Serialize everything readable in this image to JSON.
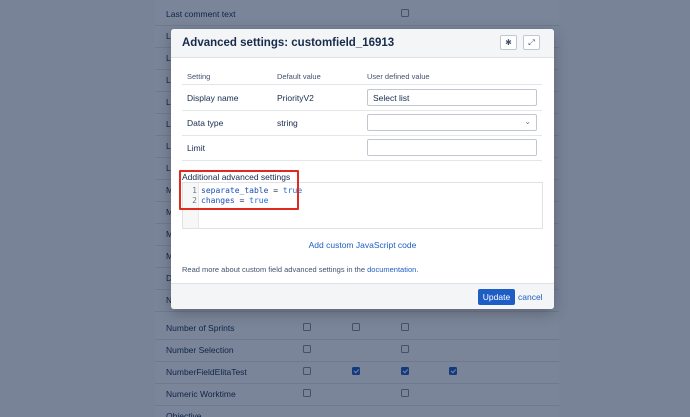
{
  "background": {
    "rows": [
      {
        "label": "Last comment text",
        "checks": [
          false,
          null,
          null,
          null
        ]
      },
      {
        "label": "L",
        "checks": [
          null,
          null,
          null,
          null
        ]
      },
      {
        "label": "L",
        "checks": [
          null,
          null,
          null,
          null
        ]
      },
      {
        "label": "L",
        "checks": [
          null,
          null,
          null,
          null
        ]
      },
      {
        "label": "L",
        "checks": [
          null,
          null,
          null,
          null
        ]
      },
      {
        "label": "L",
        "checks": [
          null,
          null,
          null,
          null
        ]
      },
      {
        "label": "L",
        "checks": [
          null,
          null,
          null,
          null
        ]
      },
      {
        "label": "L",
        "checks": [
          null,
          null,
          null,
          null
        ]
      },
      {
        "label": "M",
        "checks": [
          null,
          null,
          null,
          null
        ]
      },
      {
        "label": "M",
        "checks": [
          null,
          null,
          null,
          null
        ]
      },
      {
        "label": "M",
        "checks": [
          null,
          null,
          null,
          null
        ]
      },
      {
        "label": "M",
        "checks": [
          null,
          null,
          null,
          null
        ]
      },
      {
        "label": "D",
        "checks": [
          null,
          null,
          null,
          null
        ]
      },
      {
        "label": "N",
        "checks": [
          null,
          null,
          null,
          null
        ]
      },
      {
        "label": "Number of Sprints",
        "checks": [
          false,
          false,
          false,
          null
        ]
      },
      {
        "label": "Number Selection",
        "checks": [
          false,
          null,
          false,
          null
        ]
      },
      {
        "label": "NumberFieldElitaTest",
        "checks": [
          false,
          true,
          true,
          true
        ]
      },
      {
        "label": "Numeric Worktime",
        "checks": [
          false,
          null,
          false,
          null
        ]
      },
      {
        "label": "Objective",
        "checks": [
          null,
          null,
          null,
          null
        ]
      }
    ]
  },
  "modal": {
    "title": "Advanced settings: customfield_16913",
    "header_icons": [
      "sparkle-icon",
      "expand-icon"
    ],
    "columns": {
      "setting": "Setting",
      "default": "Default value",
      "user": "User defined value"
    },
    "rows": {
      "display_name": {
        "label": "Display name",
        "default": "PriorityV2",
        "user": "Select list"
      },
      "data_type": {
        "label": "Data type",
        "default": "string",
        "user": ""
      },
      "limit": {
        "label": "Limit",
        "default": "",
        "user": ""
      }
    },
    "additional_label": "Additional advanced settings",
    "code": [
      {
        "n": "1",
        "key": "separate_table",
        "op": " = ",
        "val": "true"
      },
      {
        "n": "2",
        "key": "changes",
        "op": " = ",
        "val": "true"
      }
    ],
    "add_js_link": "Add custom JavaScript code",
    "read_more_prefix": "Read more about custom field advanced settings in the ",
    "read_more_link": "documentation",
    "read_more_suffix": ".",
    "update_button": "Update",
    "cancel_link": "cancel"
  },
  "colors": {
    "accent": "#1f5dc6",
    "highlight": "#e0291f",
    "overlay": "rgba(9,30,66,0.54)"
  }
}
